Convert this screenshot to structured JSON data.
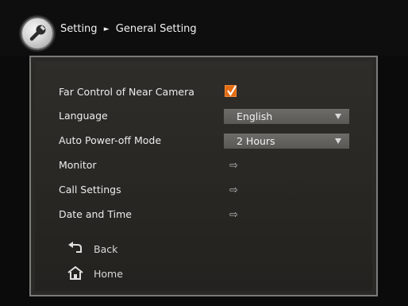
{
  "header": {
    "breadcrumb_parent": "Setting",
    "breadcrumb_separator": "►",
    "breadcrumb_current": "General Setting",
    "icon": "wrench-icon"
  },
  "settings": [
    {
      "label": "Far Control of Near Camera",
      "control": "checkbox",
      "checked": true
    },
    {
      "label": "Language",
      "control": "select",
      "value": "English"
    },
    {
      "label": "Auto Power-off Mode",
      "control": "select",
      "value": "2 Hours"
    },
    {
      "label": "Monitor",
      "control": "link",
      "symbol": "⇨"
    },
    {
      "label": "Call Settings",
      "control": "link",
      "symbol": "⇨"
    },
    {
      "label": "Date and Time",
      "control": "link",
      "symbol": "⇨"
    }
  ],
  "nav": {
    "back": {
      "label": "Back",
      "icon": "back-arrow-icon"
    },
    "home": {
      "label": "Home",
      "icon": "home-icon"
    }
  },
  "colors": {
    "accent_checkbox": "#e36b12",
    "panel_bg": "#2a2925",
    "select_bg": "#6d6c68"
  }
}
